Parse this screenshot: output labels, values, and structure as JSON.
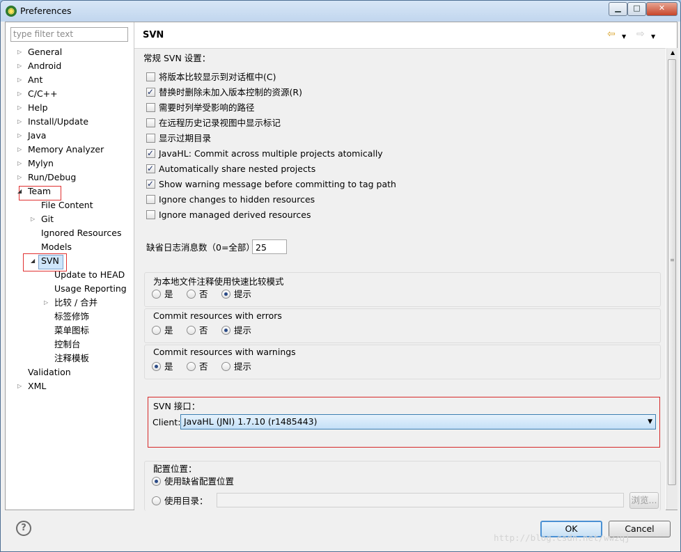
{
  "window": {
    "title": "Preferences",
    "controls": {
      "minimize": "▁",
      "maximize": "□",
      "close": "✕"
    }
  },
  "sidebar": {
    "filter_placeholder": "type filter text",
    "items": [
      {
        "label": "General"
      },
      {
        "label": "Android"
      },
      {
        "label": "Ant"
      },
      {
        "label": "C/C++"
      },
      {
        "label": "Help"
      },
      {
        "label": "Install/Update"
      },
      {
        "label": "Java"
      },
      {
        "label": "Memory Analyzer"
      },
      {
        "label": "Mylyn"
      },
      {
        "label": "Run/Debug"
      },
      {
        "label": "Team"
      },
      {
        "label": "File Content"
      },
      {
        "label": "Git"
      },
      {
        "label": "Ignored Resources"
      },
      {
        "label": "Models"
      },
      {
        "label": "SVN"
      },
      {
        "label": "Update to HEAD"
      },
      {
        "label": "Usage Reporting"
      },
      {
        "label": "比较 / 合并"
      },
      {
        "label": "标签修饰"
      },
      {
        "label": "菜单图标"
      },
      {
        "label": "控制台"
      },
      {
        "label": "注释模板"
      },
      {
        "label": "Validation"
      },
      {
        "label": "XML"
      }
    ]
  },
  "page": {
    "title": "SVN",
    "general_label": "常规 SVN 设置：",
    "checkboxes": [
      {
        "label": "将版本比较显示到对话框中(C)",
        "checked": false
      },
      {
        "label": "替换时删除未加入版本控制的资源(R)",
        "checked": true
      },
      {
        "label": "需要时列举受影响的路径",
        "checked": false
      },
      {
        "label": "在远程历史记录视图中显示标记",
        "checked": false
      },
      {
        "label": "显示过期目录",
        "checked": false
      },
      {
        "label": "JavaHL: Commit across multiple projects atomically",
        "checked": true
      },
      {
        "label": "Automatically share nested projects",
        "checked": true
      },
      {
        "label": "Show warning message before committing to tag path",
        "checked": true
      },
      {
        "label": "Ignore changes to hidden resources",
        "checked": false
      },
      {
        "label": "Ignore managed derived resources",
        "checked": false
      }
    ],
    "log_label": "缺省日志消息数（0=全部）",
    "log_value": "25",
    "groups": [
      {
        "title": "为本地文件注释使用快速比较模式",
        "options": [
          "是",
          "否",
          "提示"
        ],
        "selected": "提示"
      },
      {
        "title": "Commit resources with errors",
        "options": [
          "是",
          "否",
          "提示"
        ],
        "selected": "提示"
      },
      {
        "title": "Commit resources with warnings",
        "options": [
          "是",
          "否",
          "提示"
        ],
        "selected": "是"
      }
    ],
    "svn_interface": {
      "title": "SVN 接口：",
      "client_label": "Client:",
      "client_value": "JavaHL (JNI) 1.7.10 (r1485443)"
    },
    "config_location": {
      "title": "配置位置：",
      "default_option": "使用缺省配置位置",
      "dir_option": "使用目录：",
      "browse_label": "浏览..."
    }
  },
  "footer": {
    "ok_label": "OK",
    "cancel_label": "Cancel",
    "watermark": "http://blog.csdn.net/wwzqj"
  }
}
